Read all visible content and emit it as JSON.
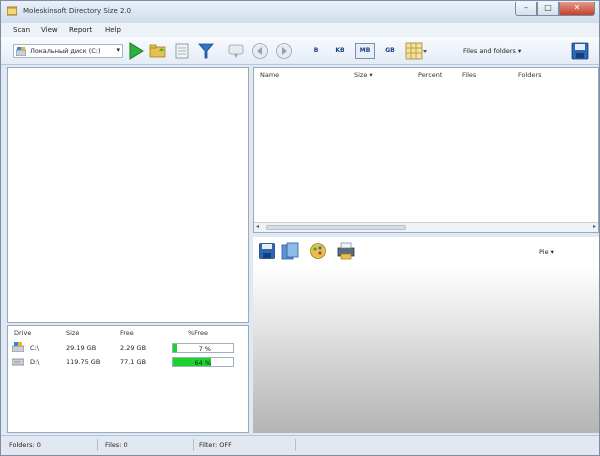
{
  "window": {
    "title": "Moleskinsoft Directory Size 2.0",
    "controls": {
      "minimize": "–",
      "maximize": "□",
      "close": "✕"
    }
  },
  "menu": {
    "items": [
      "Scan",
      "View",
      "Report",
      "Help"
    ]
  },
  "toolbar": {
    "drive_select": "Локальный диск (C:)",
    "units": [
      "B",
      "KB",
      "MB",
      "GB"
    ],
    "active_unit": "MB",
    "view_mode": "Files and folders"
  },
  "list": {
    "columns": [
      "Name",
      "Size",
      "Percent",
      "Files",
      "Folders"
    ],
    "rows": []
  },
  "chart": {
    "type_select": "Pie"
  },
  "drives": {
    "headers": [
      "Drive",
      "Size",
      "Free",
      "%Free"
    ],
    "rows": [
      {
        "drive": "C:\\",
        "size": "29.19 GB",
        "free": "2.29 GB",
        "pct_label": "7 %",
        "pct_free": 0.07
      },
      {
        "drive": "D:\\",
        "size": "119.75 GB",
        "free": "77.1 GB",
        "pct_label": "64 %",
        "pct_free": 0.64
      }
    ]
  },
  "status": {
    "folders": "Folders: 0",
    "files": "Files: 0",
    "filter": "Filter: OFF"
  },
  "colors": {
    "free_bar": "#19d42a",
    "title_close": "#c2412c",
    "accent": "#1a3f86"
  }
}
